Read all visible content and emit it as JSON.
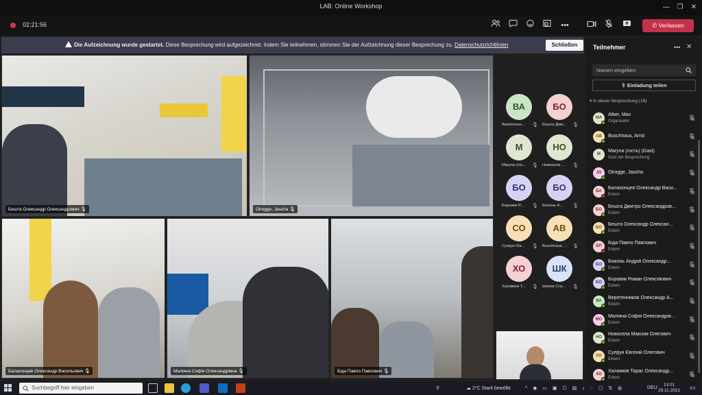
{
  "window": {
    "title": "LAB: Online Workshop"
  },
  "toolbar": {
    "timer": "02:21:56",
    "leave_label": "Verlassen"
  },
  "banner": {
    "title": "Die Aufzeichnung wurde gestartet.",
    "text": "Diese Besprechung wird aufgezeichnet. Indem Sie teilnehmen, stimmen Sie der Aufzeichnung dieser Besprechung zu.",
    "link": "Datenschutzrichtlinien",
    "close_label": "Schließen"
  },
  "video_tiles": [
    {
      "name": "Бешта Олександр Олександрович"
    },
    {
      "name": "Olrogge, Jascha"
    },
    {
      "name": "Балахонцев Олександр Васильович"
    },
    {
      "name": "Маліяна Софія Олександрівна"
    },
    {
      "name": "Біда Павло Павлович"
    }
  ],
  "avatars": [
    {
      "initials": "ВА",
      "name": "Веретеннн...",
      "bg": "#c9e6c4",
      "fg": "#2f5d2a"
    },
    {
      "initials": "БО",
      "name": "Бешта Дми...",
      "bg": "#f6cfd3",
      "fg": "#7a2230"
    },
    {
      "initials": "M",
      "name": "Maryna (гос...",
      "bg": "#dfe6cf",
      "fg": "#3f4a2a"
    },
    {
      "initials": "НО",
      "name": "Новосела ...",
      "bg": "#dfe8cf",
      "fg": "#3b4a26"
    },
    {
      "initials": "БО",
      "name": "Боровик Р...",
      "bg": "#d6d3f2",
      "fg": "#35317a"
    },
    {
      "initials": "БО",
      "name": "Біхконь А...",
      "bg": "#d6d3f2",
      "fg": "#35317a"
    },
    {
      "initials": "СО",
      "name": "Супрун Єв...",
      "bg": "#f7e0b5",
      "fg": "#6d4b10"
    },
    {
      "initials": "AB",
      "name": "Buschhaus, ...",
      "bg": "#f7e0b5",
      "fg": "#6d4b10"
    },
    {
      "initials": "ХО",
      "name": "Халаімов Т...",
      "bg": "#f6cfd3",
      "fg": "#7a2230"
    },
    {
      "initials": "ШК",
      "name": "Шиков Ста...",
      "bg": "#d9e2f6",
      "fg": "#2b3f6b"
    }
  ],
  "panel": {
    "title": "Teilnehmer",
    "search_placeholder": "Namen eingeben",
    "invite_label": "Einladung teilen",
    "section_label": "In dieser Besprechung (16)",
    "participants": [
      {
        "initials": "MA",
        "name": "Alber, Max",
        "sub": "Organisator",
        "bg": "#dfe3c9",
        "fg": "#4a4f26",
        "status": "#6bb700"
      },
      {
        "initials": "AB",
        "name": "Buschhaus, Arnd",
        "sub": "",
        "bg": "#f7e0b5",
        "fg": "#6d4b10",
        "status": "#6bb700"
      },
      {
        "initials": "M",
        "name": "Maryna (гость) (Gast)",
        "sub": "Gast der Besprechung",
        "bg": "#dfe6cf",
        "fg": "#3f4a2a",
        "status": ""
      },
      {
        "initials": "JO",
        "name": "Olrogge, Jascha",
        "sub": "",
        "bg": "#f6cfe6",
        "fg": "#6d2250",
        "status": "#6bb700"
      },
      {
        "initials": "БА",
        "name": "Балахонцев Олександр Васи...",
        "sub": "Extern",
        "bg": "#f6cfd3",
        "fg": "#7a2230",
        "status": "#c4314b"
      },
      {
        "initials": "БО",
        "name": "Бешта Дмитро Олександров...",
        "sub": "Extern",
        "bg": "#f6cfd3",
        "fg": "#7a2230",
        "status": "#6bb700"
      },
      {
        "initials": "БО",
        "name": "Бешта Олександр Олексан...",
        "sub": "Extern",
        "bg": "#f7e0b5",
        "fg": "#6d4b10",
        "status": "#6bb700"
      },
      {
        "initials": "БП",
        "name": "Біда Павло Павлович",
        "sub": "Extern",
        "bg": "#f6cfd3",
        "fg": "#7a2230",
        "status": "#c4314b"
      },
      {
        "initials": "БО",
        "name": "Біхконь Андрій Олександр...",
        "sub": "Extern",
        "bg": "#d6d3f2",
        "fg": "#35317a",
        "status": "#6bb700"
      },
      {
        "initials": "БО",
        "name": "Боровик Роман Олексійович",
        "sub": "Extern",
        "bg": "#d6d3f2",
        "fg": "#35317a",
        "status": "#6bb700"
      },
      {
        "initials": "ВА",
        "name": "Веретенников Олександр А...",
        "sub": "Extern",
        "bg": "#c9e6c4",
        "fg": "#2f5d2a",
        "status": "#6bb700"
      },
      {
        "initials": "МО",
        "name": "Маліяна Софія Олександрів...",
        "sub": "Extern",
        "bg": "#f6cfe6",
        "fg": "#6d2250",
        "status": "#6bb700"
      },
      {
        "initials": "НО",
        "name": "Новосела Максим Олегович",
        "sub": "Extern",
        "bg": "#dfe8cf",
        "fg": "#3b4a26",
        "status": "#6bb700"
      },
      {
        "initials": "СО",
        "name": "Супрун Євгеній Олегович",
        "sub": "Extern",
        "bg": "#f7e0b5",
        "fg": "#6d4b10",
        "status": "#6bb700"
      },
      {
        "initials": "ХО",
        "name": "Халаімов Тарас Олександр...",
        "sub": "Extern",
        "bg": "#f6cfd3",
        "fg": "#7a2230",
        "status": "#6bb700"
      }
    ]
  },
  "taskbar": {
    "search_placeholder": "Suchbegriff hier eingeben",
    "weather": "2°C  Stark bewölkt",
    "lang": "DEU",
    "time": "13:01",
    "date": "29.11.2021"
  }
}
